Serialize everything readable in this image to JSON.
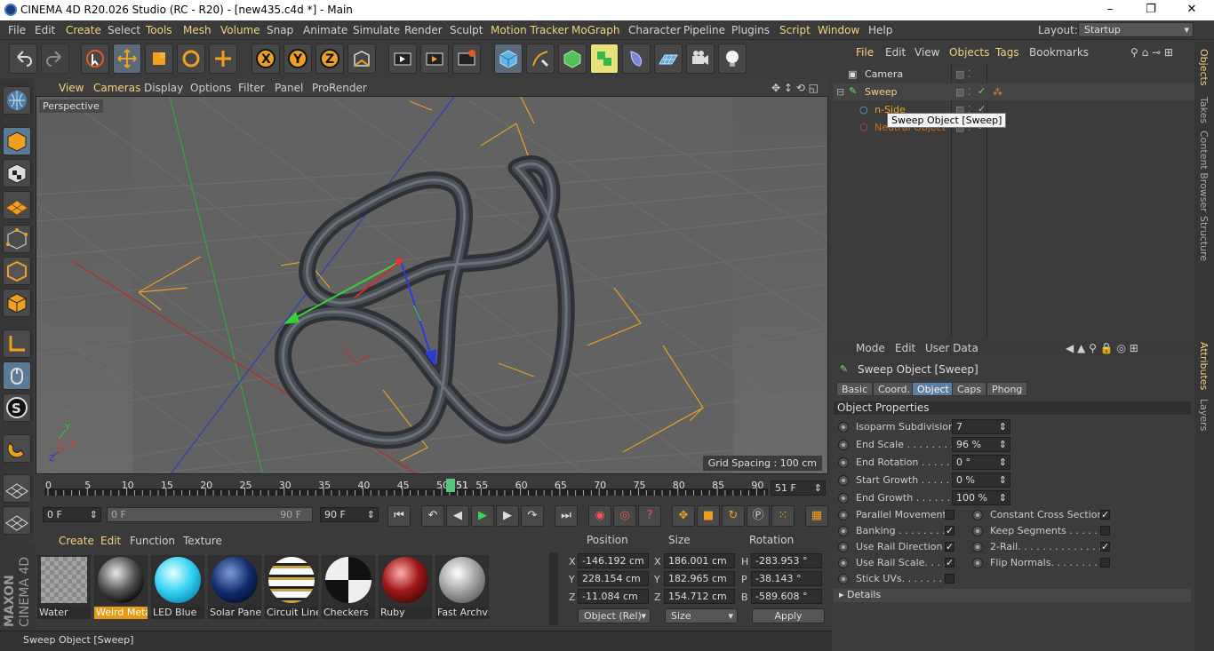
{
  "window": {
    "title": "CINEMA 4D R20.026 Studio (RC - R20) - [new435.c4d *] - Main",
    "controls": [
      "–",
      "❐",
      "✕"
    ]
  },
  "menubar": {
    "items": [
      "File",
      "Edit",
      "Create",
      "Select",
      "Tools",
      "Mesh",
      "Volume",
      "Snap",
      "Animate",
      "Simulate",
      "Render",
      "Sculpt",
      "Motion Tracker",
      "MoGraph",
      "Character",
      "Pipeline",
      "Plugins",
      "Script",
      "Window",
      "Help"
    ],
    "layout_label": "Layout:",
    "layout_value": "Startup"
  },
  "viewport": {
    "menu": [
      "View",
      "Cameras",
      "Display",
      "Options",
      "Filter",
      "Panel",
      "ProRender"
    ],
    "label": "Perspective",
    "grid_spacing": "Grid Spacing : 100 cm",
    "axis": {
      "x": "X",
      "y": "Y",
      "z": "Z"
    }
  },
  "timeline": {
    "ticks": [
      "0",
      "5",
      "10",
      "15",
      "20",
      "25",
      "30",
      "35",
      "40",
      "45",
      "50",
      "55",
      "60",
      "65",
      "70",
      "75",
      "80",
      "85",
      "90"
    ],
    "current_frame": "51",
    "end_field": "51 F"
  },
  "transport": {
    "start": "0 F",
    "min": "0 F",
    "max": "90 F",
    "end": "90 F"
  },
  "materials": {
    "menu": [
      "Create",
      "Edit",
      "Function",
      "Texture"
    ],
    "items": [
      "Water",
      "Weird Meta",
      "LED Blue",
      "Solar Panel",
      "Circuit Line",
      "Checkers",
      "Ruby",
      "Fast Archvi"
    ],
    "selected": "Weird Meta"
  },
  "coordinates": {
    "headers": [
      "Position",
      "Size",
      "Rotation"
    ],
    "rows": [
      {
        "axis": "X",
        "pos": "-146.192 cm",
        "size_axis": "X",
        "size": "186.001 cm",
        "rot_axis": "H",
        "rot": "-283.953 °"
      },
      {
        "axis": "Y",
        "pos": "228.154 cm",
        "size_axis": "Y",
        "size": "182.965 cm",
        "rot_axis": "P",
        "rot": "-38.143 °"
      },
      {
        "axis": "Z",
        "pos": "-11.084 cm",
        "size_axis": "Z",
        "size": "154.712 cm",
        "rot_axis": "B",
        "rot": "-589.608 °"
      }
    ],
    "mode": "Object (Rel)",
    "size_mode": "Size",
    "apply": "Apply"
  },
  "statusbar": {
    "text": "Sweep Object [Sweep]"
  },
  "objects": {
    "menu": [
      "File",
      "Edit",
      "View",
      "Objects",
      "Tags",
      "Bookmarks"
    ],
    "rows": [
      {
        "name": "Camera"
      },
      {
        "name": "Sweep"
      },
      {
        "name": "n-Side"
      },
      {
        "name": "Neutral Object"
      }
    ],
    "tooltip": "Sweep Object [Sweep]"
  },
  "attributes": {
    "menu": [
      "Mode",
      "Edit",
      "User Data"
    ],
    "title": "Sweep Object [Sweep]",
    "tabs": [
      "Basic",
      "Coord.",
      "Object",
      "Caps",
      "Phong"
    ],
    "active_tab": "Object",
    "section": "Object Properties",
    "props": [
      {
        "label": "Isoparm Subdivision",
        "value": "7"
      },
      {
        "label": "End Scale . . . . . . . . . .",
        "value": "96 %"
      },
      {
        "label": "End Rotation . . . . . .",
        "value": "0 °"
      },
      {
        "label": "Start Growth . . . . . .",
        "value": "0 %"
      },
      {
        "label": "End Growth . . . . . . .",
        "value": "100 %"
      }
    ],
    "checks_left": [
      {
        "label": "Parallel Movement",
        "checked": false
      },
      {
        "label": "Banking . . . . . . . . .",
        "checked": true
      },
      {
        "label": "Use Rail Direction",
        "checked": true
      },
      {
        "label": "Use Rail Scale. . . .",
        "checked": true
      },
      {
        "label": "Stick UVs. . . . . . . .",
        "checked": false
      }
    ],
    "checks_right": [
      {
        "label": "Constant Cross Section",
        "checked": true
      },
      {
        "label": "Keep Segments . . . . . . .",
        "checked": false
      },
      {
        "label": "2-Rail. . . . . . . . . . . . . . .",
        "checked": true
      },
      {
        "label": "Flip Normals. . . . . . . . .",
        "checked": false
      }
    ],
    "details": "Details"
  },
  "side_tabs": {
    "right": [
      "Objects",
      "Takes",
      "Content Browser",
      "Structure",
      "Attributes",
      "Layers"
    ],
    "logo": [
      "MAXON",
      "CINEMA 4D"
    ]
  }
}
